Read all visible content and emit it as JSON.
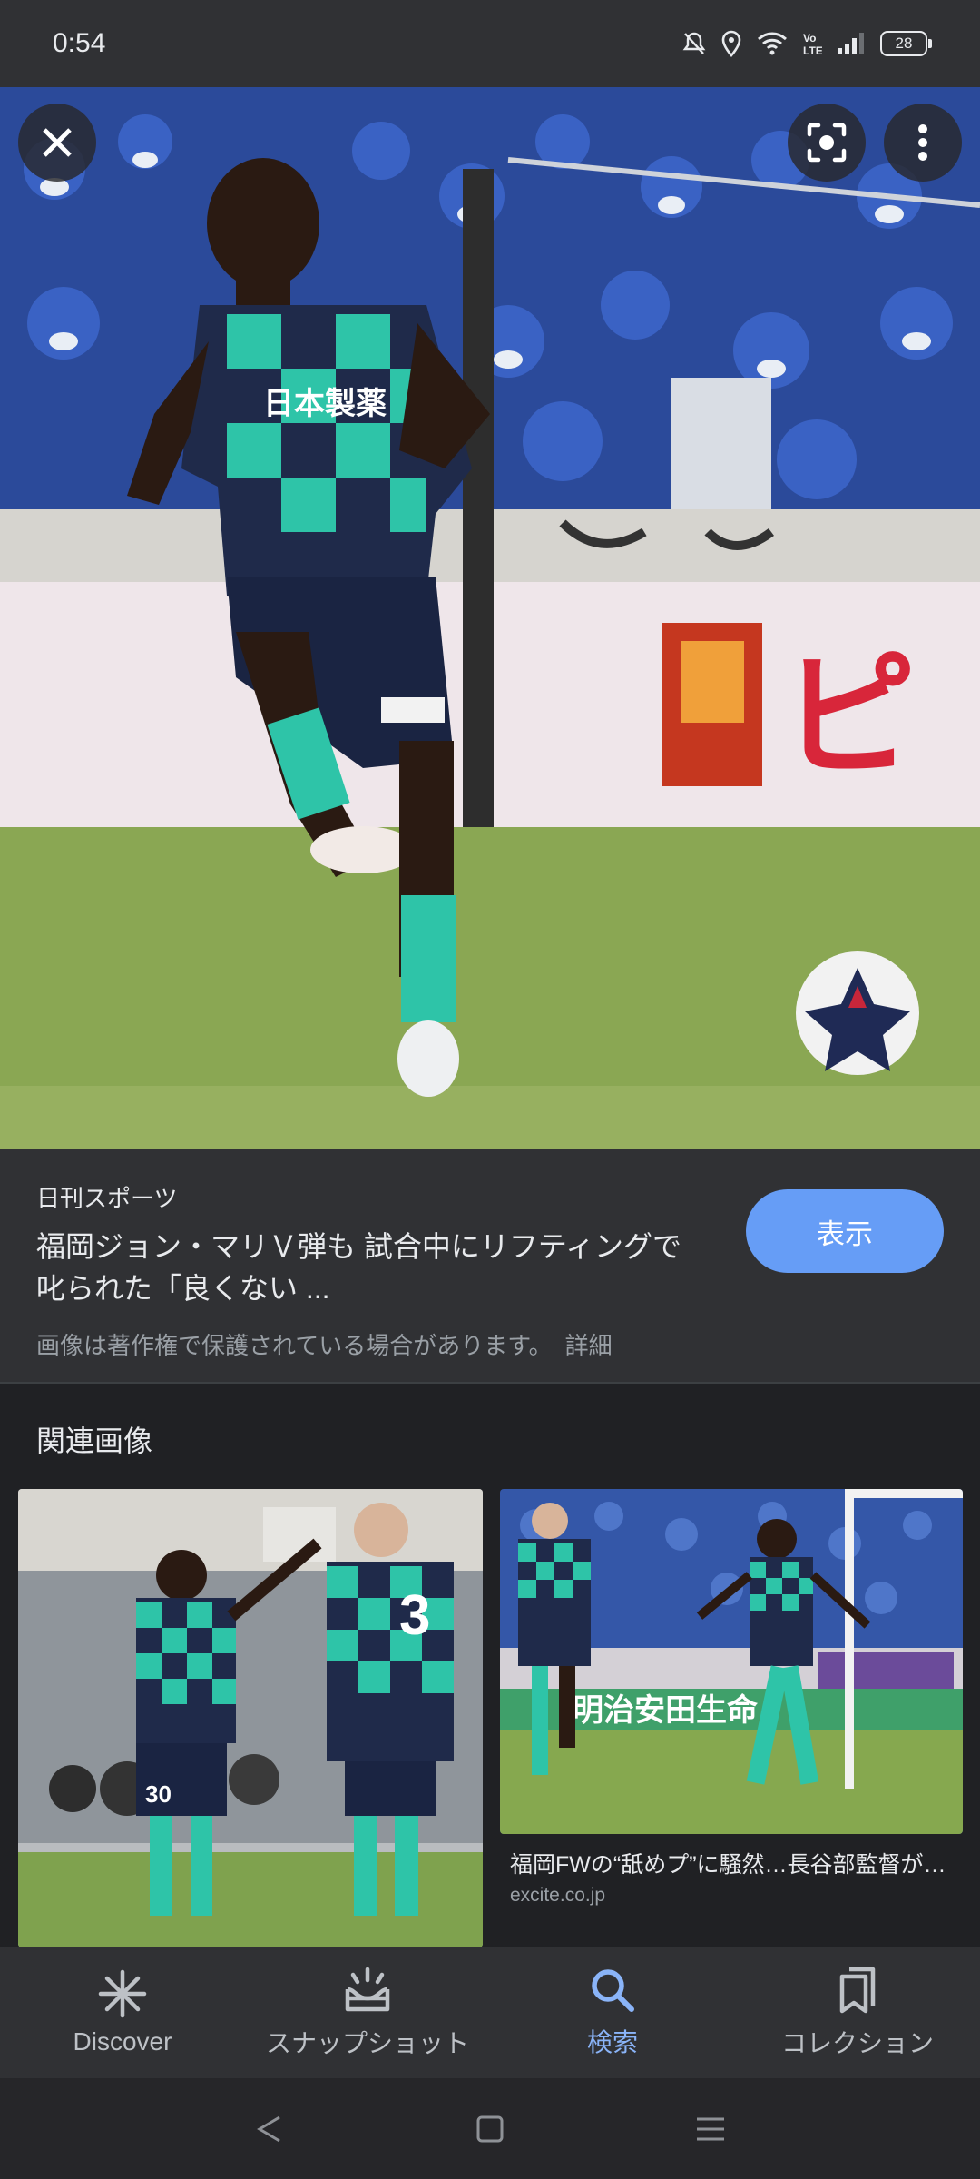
{
  "status_bar": {
    "time": "0:54",
    "battery": "28",
    "icons": [
      "mute-icon",
      "location-icon",
      "wifi-icon",
      "volte-icon",
      "signal-icon",
      "battery-icon"
    ]
  },
  "viewer": {
    "close_icon": "close-icon",
    "lens_icon": "lens-icon",
    "more_icon": "more-vert-icon"
  },
  "result": {
    "source": "日刊スポーツ",
    "title_line1": "福岡ジョン・マリＶ弾も 試合中にリフティングで",
    "title_line2": "叱られた「良くない ...",
    "copyright_text": "画像は著作権で保護されている場合があります。",
    "details_link": "詳細",
    "view_button": "表示"
  },
  "related": {
    "heading": "関連画像",
    "items": [
      {
        "caption": "",
        "domain": ""
      },
      {
        "caption": "福岡FWの“舐めプ”に騒然…長谷部監督が…",
        "domain": "excite.co.jp"
      }
    ]
  },
  "bottom_nav": {
    "items": [
      {
        "label": "Discover",
        "icon": "discover-icon",
        "active": false
      },
      {
        "label": "スナップショット",
        "icon": "snapshot-icon",
        "active": false
      },
      {
        "label": "検索",
        "icon": "search-icon",
        "active": true
      },
      {
        "label": "コレクション",
        "icon": "collections-icon",
        "active": false
      }
    ]
  },
  "system_nav": [
    "back-icon",
    "home-icon",
    "recents-icon"
  ],
  "colors": {
    "accent": "#8ab4f8",
    "button": "#669df6",
    "panel": "#303134",
    "background": "#202124"
  }
}
